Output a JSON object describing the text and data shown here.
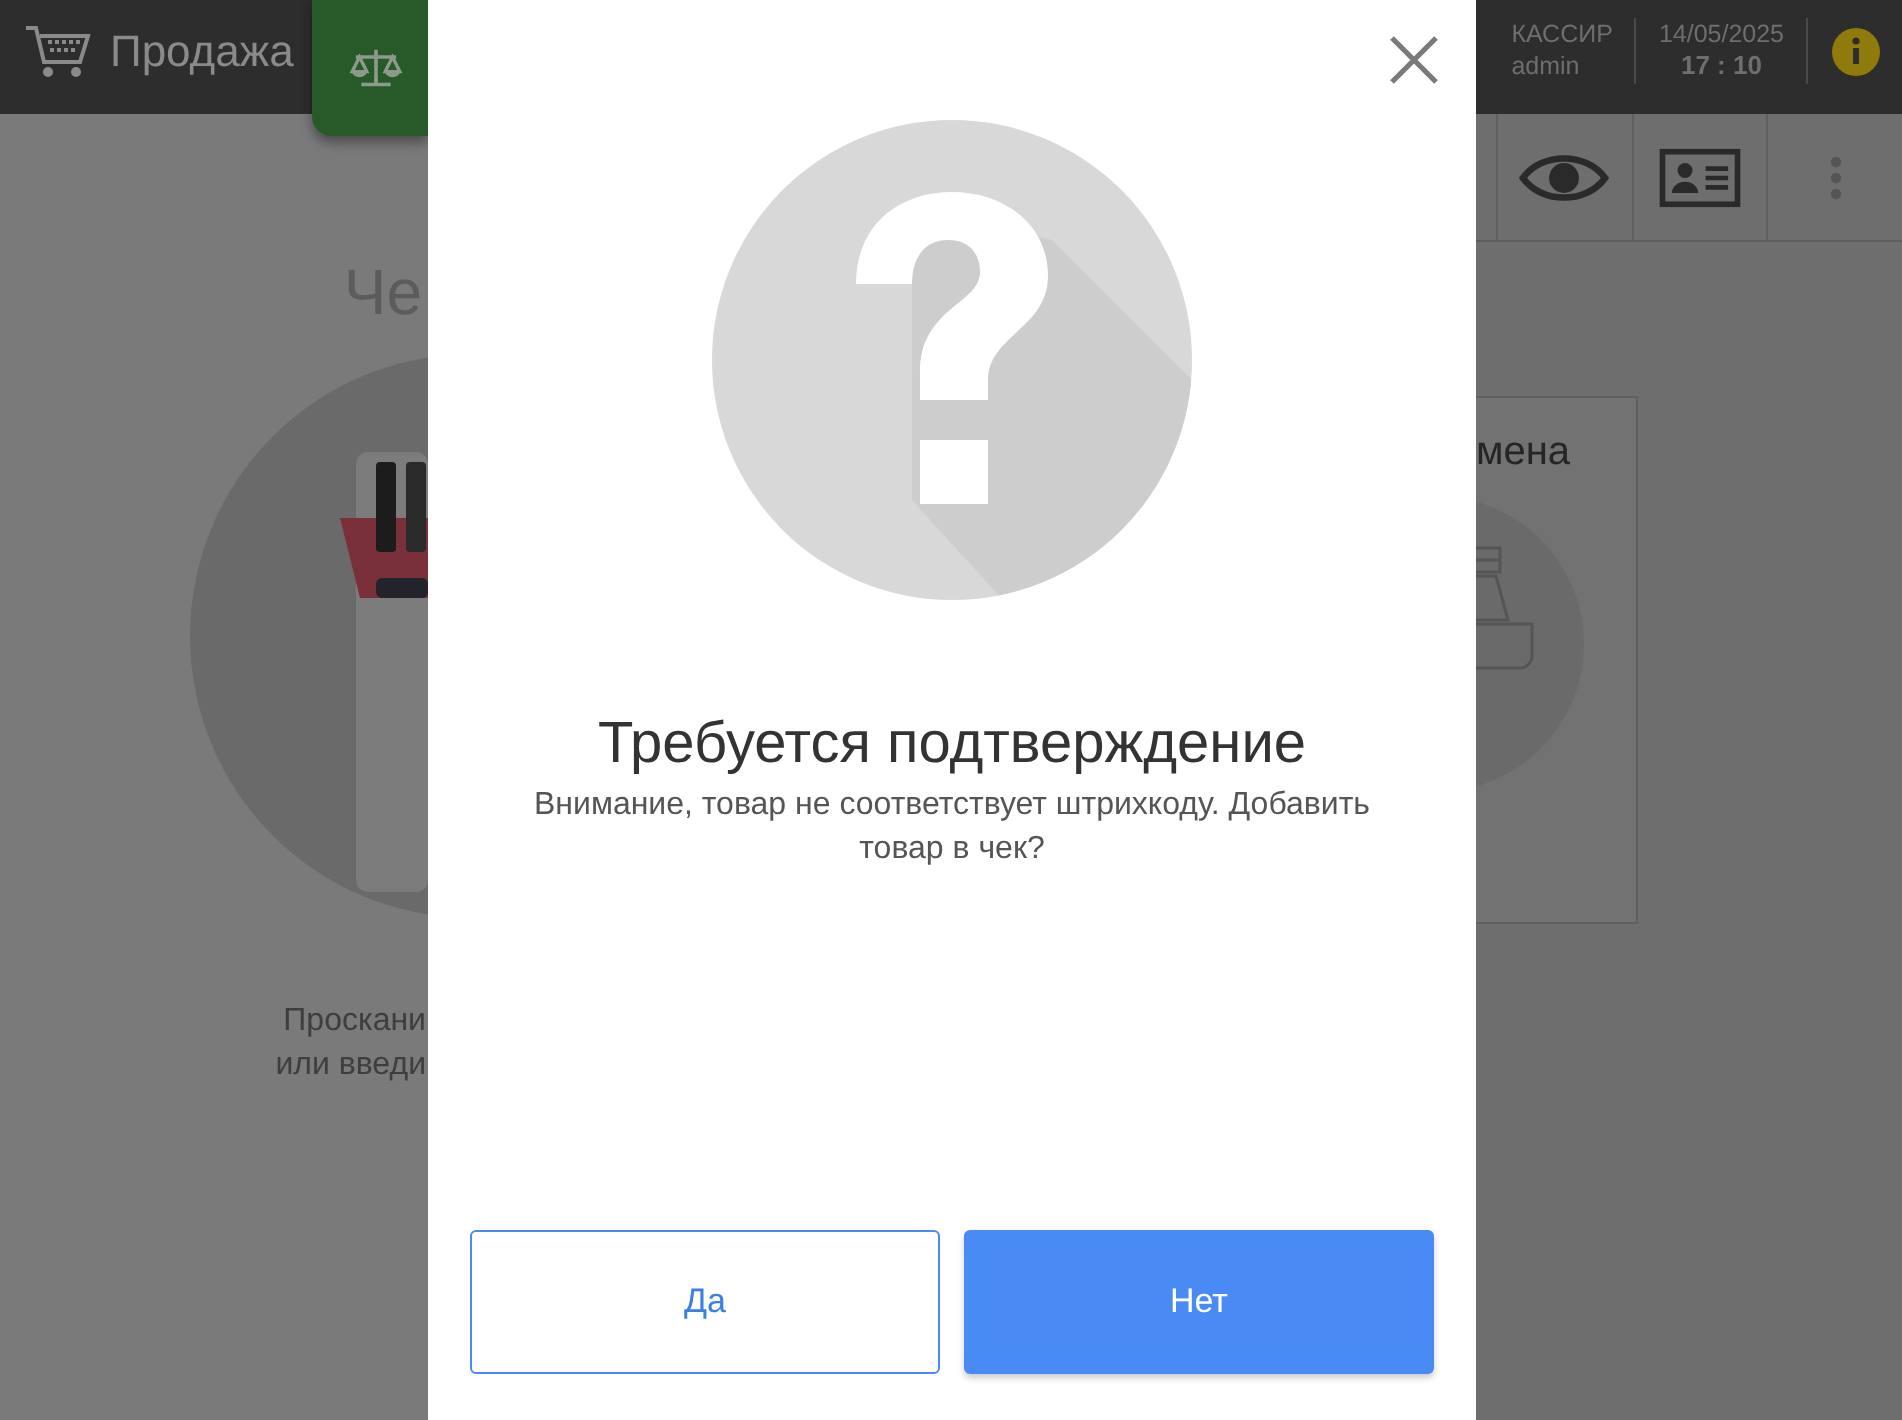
{
  "topbar": {
    "title": "Продажа",
    "cashier_label": "КАССИР",
    "cashier_name": "admin",
    "date": "14/05/2025",
    "time": "17 : 10"
  },
  "sale_panel": {
    "title": "Че",
    "hint_lines": [
      "Проскани",
      "или введи"
    ]
  },
  "shift_card": {
    "title": "мена"
  },
  "dialog": {
    "title": "Требуется подтверждение",
    "message": "Внимание, товар не соответствует штрихкоду. Добавить товар в чек?",
    "buttons": [
      {
        "label": "Да",
        "kind": "secondary"
      },
      {
        "label": "Нет",
        "kind": "primary"
      }
    ]
  }
}
